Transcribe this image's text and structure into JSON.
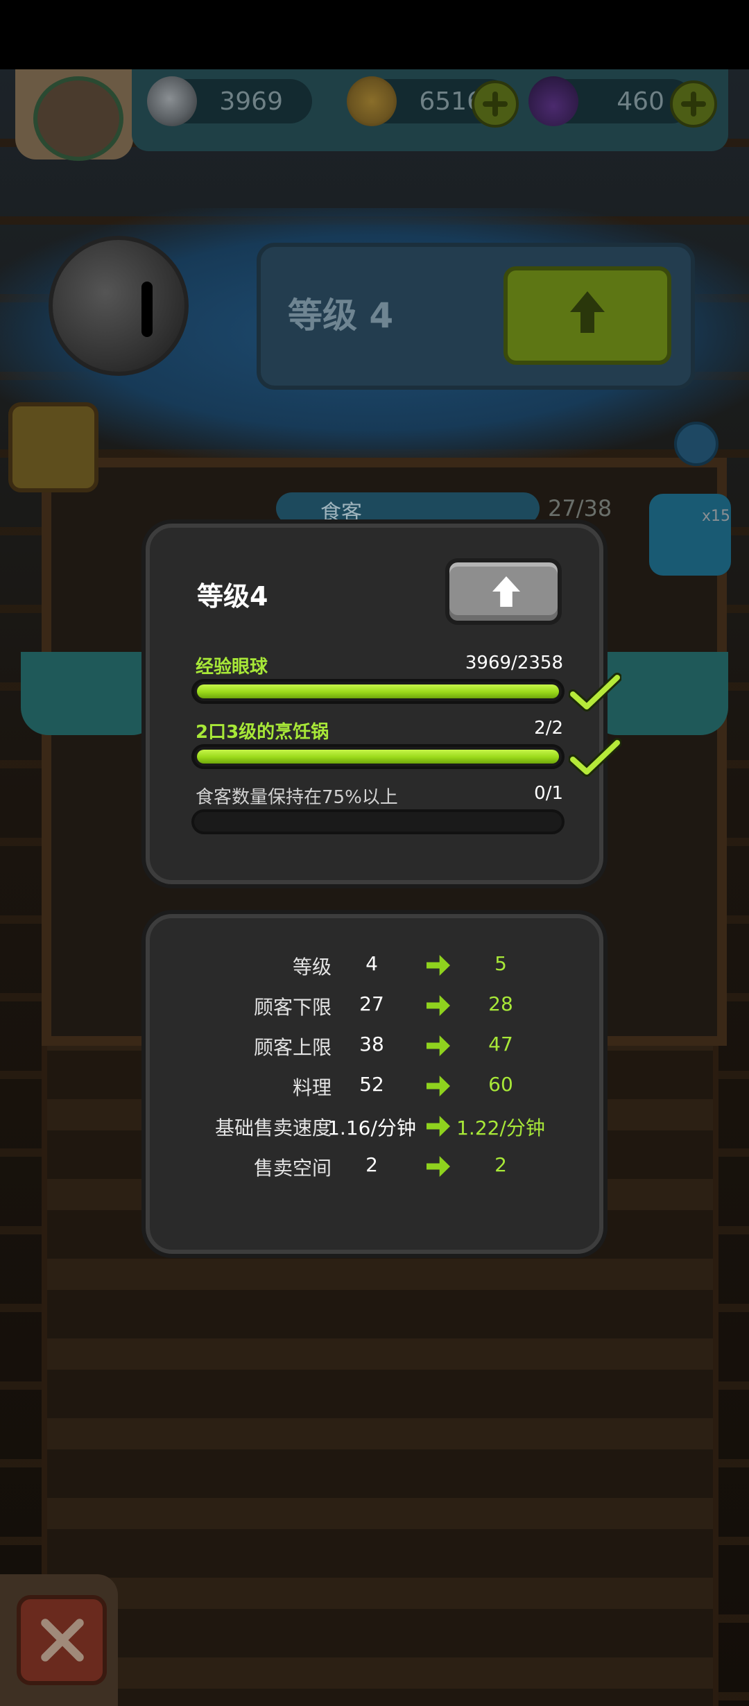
{
  "resources": {
    "eyeballs": "3969",
    "coins": "6516",
    "potions": "460"
  },
  "background": {
    "level_label": "等级 4",
    "customer_label": "食客",
    "customer_count": "27/38",
    "share_multiplier": "x15"
  },
  "dialog": {
    "title": "等级4",
    "requirements": [
      {
        "label": "经验眼球",
        "value": "3969/2358",
        "progress": 1.0,
        "complete": true
      },
      {
        "label": "2口3级的烹饪锅",
        "value": "2/2",
        "progress": 1.0,
        "complete": true
      },
      {
        "label": "食客数量保持在75%以上",
        "value": "0/1",
        "progress": 0.0,
        "complete": false
      }
    ]
  },
  "stats": [
    {
      "name": "等级",
      "from": "4",
      "to": "5"
    },
    {
      "name": "顾客下限",
      "from": "27",
      "to": "28"
    },
    {
      "name": "顾客上限",
      "from": "38",
      "to": "47"
    },
    {
      "name": "料理",
      "from": "52",
      "to": "60"
    },
    {
      "name": "基础售卖速度",
      "from": "1.16/分钟",
      "to": "1.22/分钟"
    },
    {
      "name": "售卖空间",
      "from": "2",
      "to": "2"
    }
  ],
  "colors": {
    "accent_green": "#a8e838",
    "panel_bg": "#2a2a2a"
  }
}
